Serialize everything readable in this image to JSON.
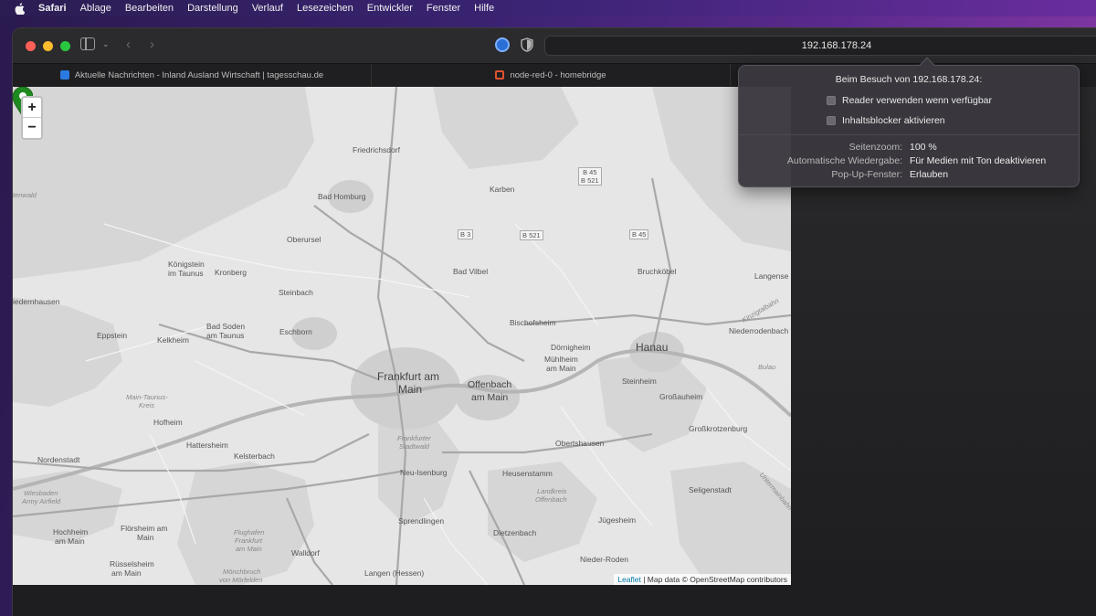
{
  "menubar": {
    "apple_icon": "apple-icon",
    "items": [
      "Safari",
      "Ablage",
      "Bearbeiten",
      "Darstellung",
      "Verlauf",
      "Lesezeichen",
      "Entwickler",
      "Fenster",
      "Hilfe"
    ]
  },
  "toolbar": {
    "url": "192.168.178.24",
    "icons": [
      "sidebar-icon",
      "chevron-down-icon",
      "back-icon",
      "forward-icon",
      "password-icon",
      "shield-icon"
    ]
  },
  "tabs": [
    {
      "label": "Aktuelle Nachrichten - Inland Ausland Wirtschaft | tagesschau.de",
      "icon": "tagesschau-icon"
    },
    {
      "label": "node-red-0 - homebridge",
      "icon": "node-red-icon"
    }
  ],
  "map": {
    "zoom_in": "+",
    "zoom_out": "−",
    "attribution_link": "Leaflet",
    "attribution_text": " | Map data © OpenStreetMap contributors",
    "labels": {
      "frankfurt_1": "Frankfurt am",
      "frankfurt_2": "Main",
      "offenbach_1": "Offenbach",
      "offenbach_2": "am Main",
      "hanau": "Hanau",
      "bad_homburg": "Bad Homburg",
      "friedrichsdorf": "Friedrichsdorf",
      "karben": "Karben",
      "oberursel": "Oberursel",
      "koenigstein_1": "Königstein",
      "koenigstein_2": "im Taunus",
      "kronberg": "Kronberg",
      "steinbach": "Steinbach",
      "bad_vilbel": "Bad Vilbel",
      "bruchkoebel": "Bruchköbel",
      "langenselbold": "Langense",
      "niedernhausen": "iedernhausen",
      "eppstein": "Eppstein",
      "kelkheim": "Kelkheim",
      "bad_soden_1": "Bad Soden",
      "bad_soden_2": "am Taunus",
      "eschborn": "Eschborn",
      "bischofsheim": "Bischofsheim",
      "doernigheim": "Dörnigheim",
      "muehlheim_1": "Mühlheim",
      "muehlheim_2": "am Main",
      "niederrodenbach": "Niederrodenbach",
      "bulau": "Bulau",
      "steinheim": "Steinheim",
      "grossauheim": "Großauheim",
      "grosskrotzenburg": "Großkrotzenburg",
      "hofheim": "Hofheim",
      "hattersheim": "Hattersheim",
      "kelsterbach": "Kelsterbach",
      "nordenstadt": "Nordenstadt",
      "obertshausen": "Obertshausen",
      "heusenstamm": "Heusenstamm",
      "neu_isenburg": "Neu-Isenburg",
      "seligenstadt": "Seligenstadt",
      "sprendlingen": "Sprendlingen",
      "dietzenbach": "Dietzenbach",
      "juegesheim": "Jügesheim",
      "hochheim_1": "Hochheim",
      "hochheim_2": "am Main",
      "floersheim_1": "Flörsheim am",
      "floersheim_2": "Main",
      "ruesselsheim_1": "Rüsselsheim",
      "ruesselsheim_2": "am Main",
      "walldorf": "Walldorf",
      "langen": "Langen (Hessen)",
      "nieder_roden": "Nieder-Roden",
      "wiesbaden_1": "Wiesbaden",
      "wiesbaden_2": "Army Airfield",
      "main_taunus_1": "Main-Taunus-",
      "main_taunus_2": "Kreis",
      "stadtwald_1": "Frankfurter",
      "stadtwald_2": "Stadtwald",
      "landkreis_1": "Landkreis",
      "landkreis_2": "Offenbach",
      "flughafen_1": "Flughafen",
      "flughafen_2": "Frankfurt",
      "flughafen_3": "am Main",
      "moenchbruch_1": "Mönchbruch",
      "moenchbruch_2": "von Mörfelden",
      "stenwald": "tenwald",
      "kinzigtalbahn": "Kinzigtalbahn",
      "untermain": "Untermainbahn"
    },
    "shields": {
      "b45_b521": [
        "B 45",
        "B 521"
      ],
      "b3": "B 3",
      "b521": "B 521",
      "b45": "B 45"
    }
  },
  "popover": {
    "title": "Beim Besuch von 192.168.178.24:",
    "reader_label": "Reader verwenden wenn verfügbar",
    "blocker_label": "Inhaltsblocker aktivieren",
    "zoom_key": "Seitenzoom:",
    "zoom_value": "100 %",
    "autoplay_key": "Automatische Wiedergabe:",
    "autoplay_value": "Für Medien mit Ton deaktivieren",
    "popup_key": "Pop-Up-Fenster:",
    "popup_value": "Erlauben"
  }
}
